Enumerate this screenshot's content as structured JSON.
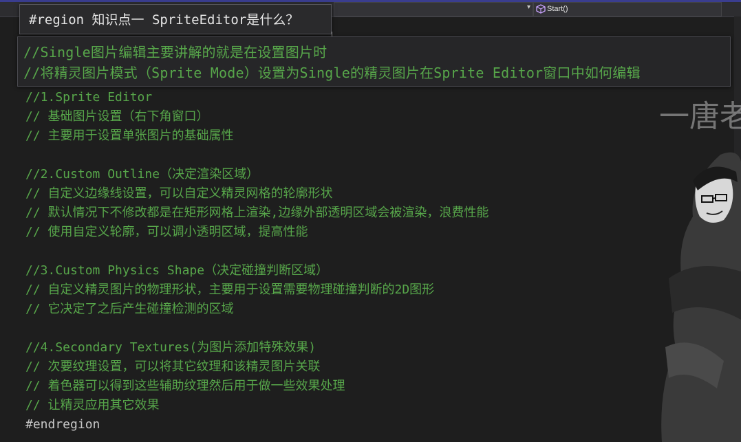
{
  "toolbar": {
    "member_label": "Start()",
    "member_icon": "method-cube-icon"
  },
  "region_tip": "#region 知识点一 SpriteEditor是什么？",
  "summary": [
    "//Single图片编辑主要讲解的就是在设置图片时",
    "//将精灵图片模式（Sprite Mode）设置为Single的精灵图片在Sprite Editor窗口中如何编辑"
  ],
  "code_lines": [
    "//1.Sprite Editor",
    "//  基础图片设置（右下角窗口）",
    "//  主要用于设置单张图片的基础属性",
    "",
    "//2.Custom Outline（决定渲染区域）",
    "//  自定义边缘线设置，可以自定义精灵网格的轮廓形状",
    "//  默认情况下不修改都是在矩形网格上渲染,边缘外部透明区域会被渲染，浪费性能",
    "//  使用自定义轮廓，可以调小透明区域，提高性能",
    "",
    "//3.Custom Physics Shape（决定碰撞判断区域）",
    "//  自定义精灵图片的物理形状，主要用于设置需要物理碰撞判断的2D图形",
    "//  它决定了之后产生碰撞检测的区域",
    "",
    "//4.Secondary Textures(为图片添加特殊效果)",
    "//  次要纹理设置，可以将其它纹理和该精灵图片关联",
    "//  着色器可以得到这些辅助纹理然后用于做一些效果处理",
    "//  让精灵应用其它效果",
    "#endregion"
  ],
  "watermark": "一唐老",
  "colors": {
    "comment": "#57a64a",
    "plain": "#c8c8c8",
    "background": "#1e1e1e"
  }
}
